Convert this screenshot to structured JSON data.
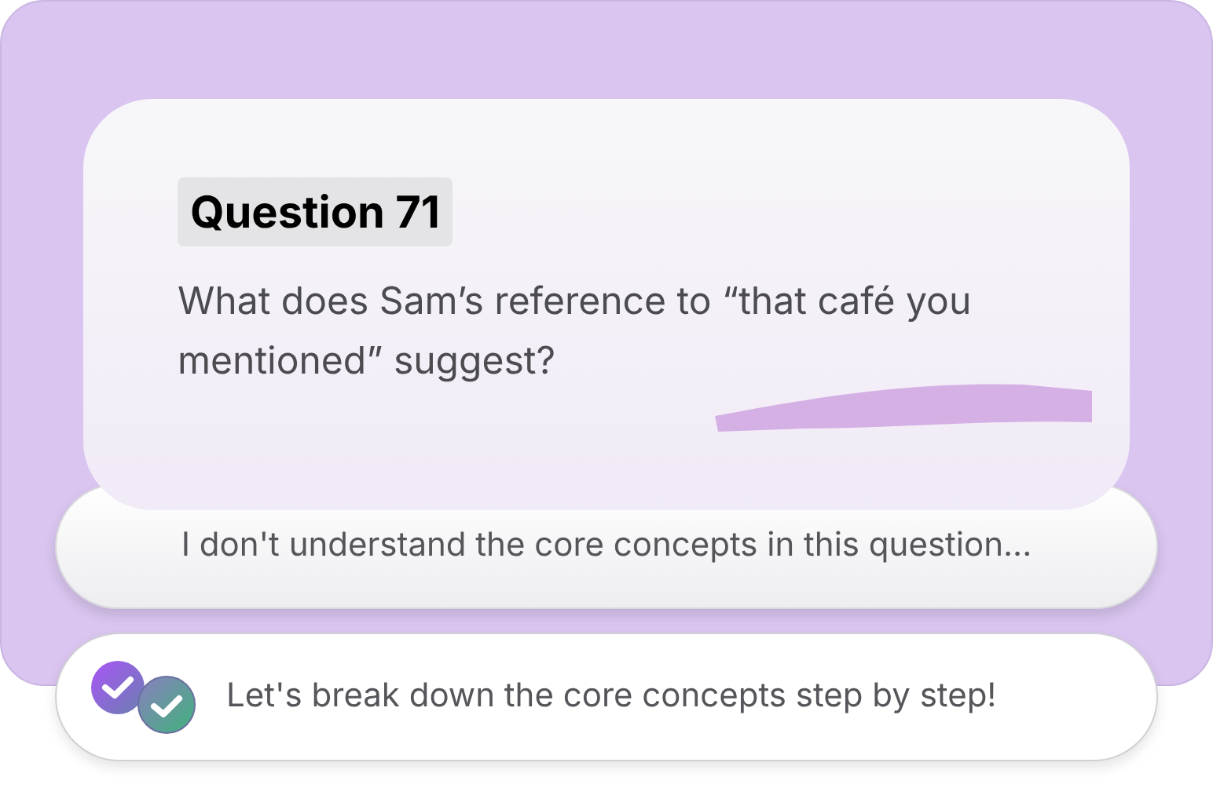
{
  "question": {
    "label": "Question 71",
    "text": "What does Sam’s reference to “that café you mentioned” suggest?"
  },
  "messages": [
    {
      "kind": "user",
      "text": "I don't understand the core concepts in this question..."
    },
    {
      "kind": "reply",
      "text": "Let's break down the core concepts step by step!"
    }
  ]
}
